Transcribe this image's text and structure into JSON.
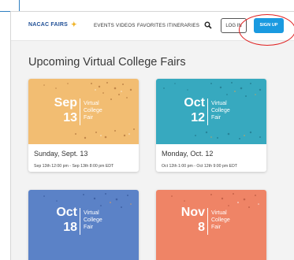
{
  "header": {
    "logo": "NACAC FAIRS",
    "nav": [
      "EVENTS",
      "VIDEOS",
      "FAVORITES",
      "ITINERARIES"
    ],
    "login_label": "LOG IN",
    "signup_label": "SIGN UP",
    "search_icon": "search-icon"
  },
  "main": {
    "title": "Upcoming Virtual College Fairs",
    "cards": [
      {
        "month": "Sep",
        "day": "13",
        "tag": [
          "Virtual",
          "College",
          "Fair"
        ],
        "title": "Sunday, Sept. 13",
        "time": "Sep 13th 12:00 pm - Sep 13th 8:00 pm EDT",
        "color": "#f2bd72"
      },
      {
        "month": "Oct",
        "day": "12",
        "tag": [
          "Virtual",
          "College",
          "Fair"
        ],
        "title": "Monday, Oct. 12",
        "time": "Oct 12th 1:00 pm - Oct 12th 9:00 pm EDT",
        "color": "#37a9bf"
      },
      {
        "month": "Oct",
        "day": "18",
        "tag": [
          "Virtual",
          "College",
          "Fair"
        ],
        "color": "#5b82c7"
      },
      {
        "month": "Nov",
        "day": "8",
        "tag": [
          "Virtual",
          "College",
          "Fair"
        ],
        "color": "#ef8466"
      }
    ]
  },
  "colors": {
    "accent": "#1a9ae0",
    "annotation": "#e02020"
  }
}
